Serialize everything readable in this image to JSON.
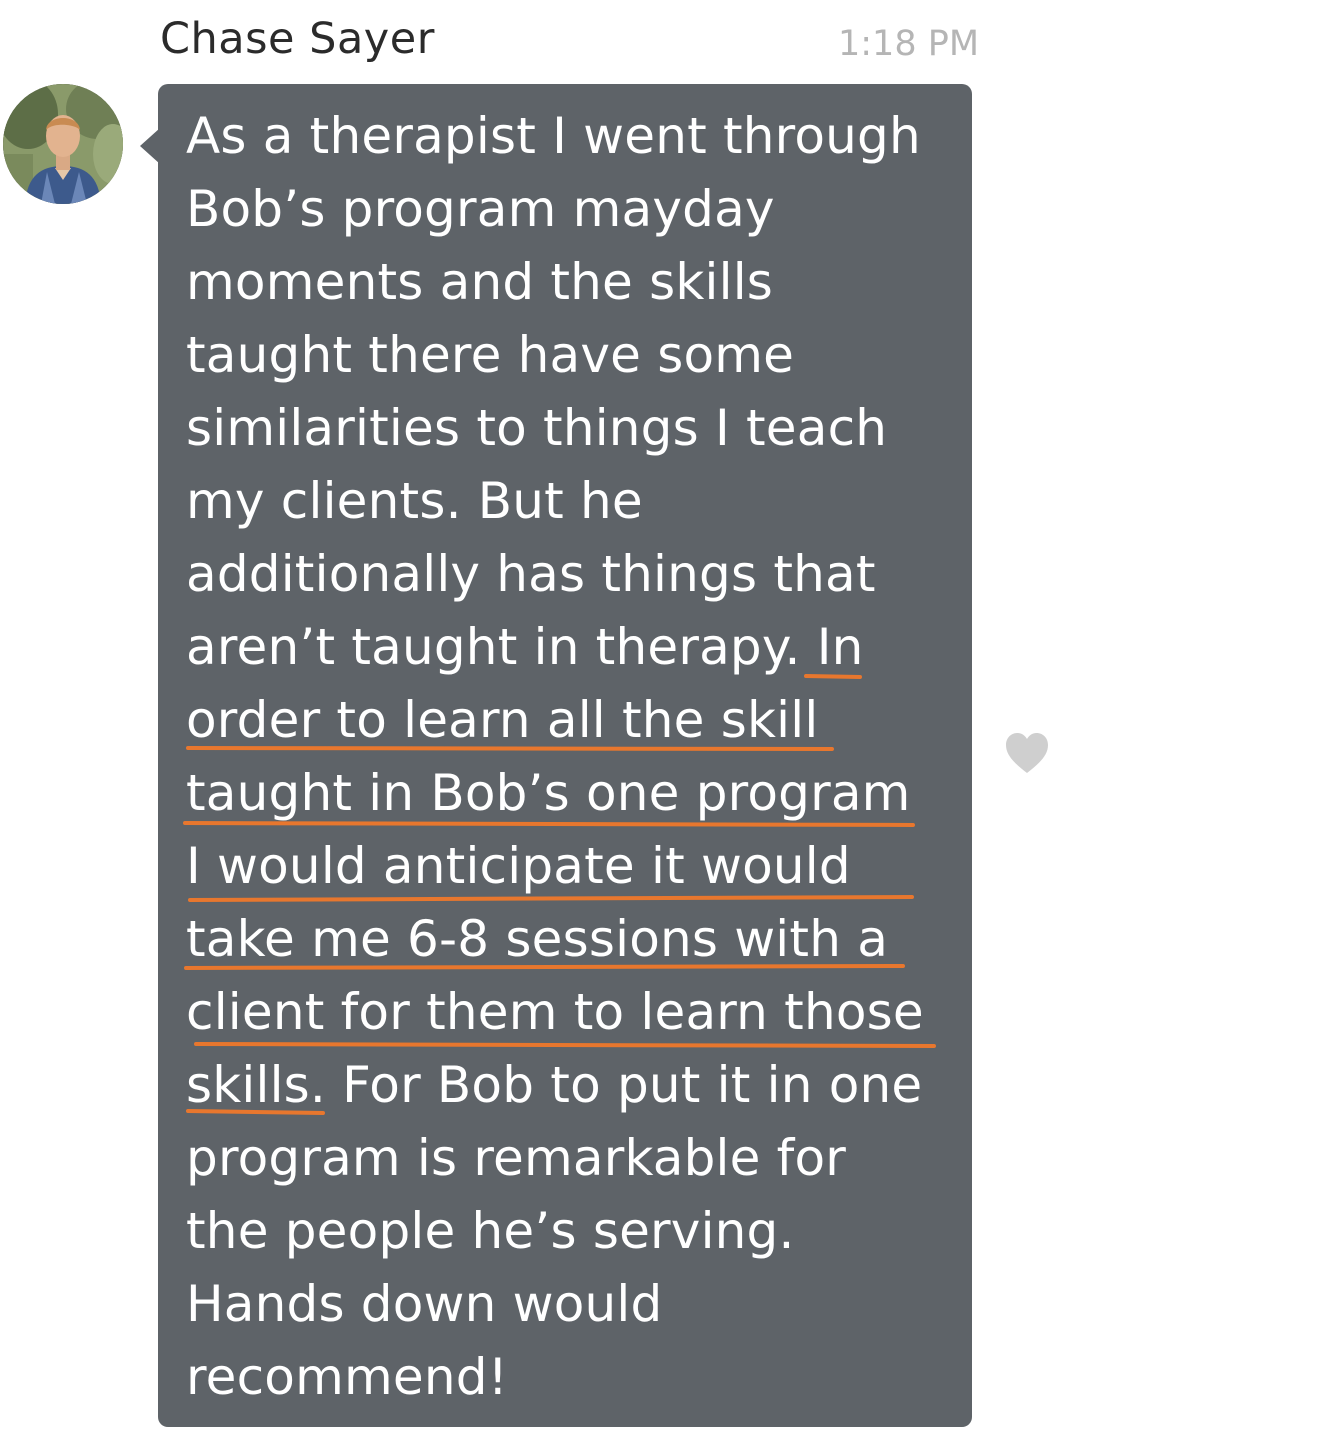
{
  "message": {
    "sender": "Chase Sayer",
    "time": "1:18 PM",
    "avatar": "avatar-photo",
    "lines": [
      "As a therapist I went through",
      "Bob’s program mayday",
      "moments and the skills",
      "taught there have some",
      "similarities to things I teach",
      "my clients. But he",
      "additionally has things that",
      "aren’t taught in therapy. In",
      "order to learn all the skill",
      "taught in Bob’s one program",
      "I would anticipate it would",
      "take me 6-8 sessions with a",
      "client for them to learn those",
      "skills. For Bob to put it in one",
      "program is remarkable for",
      "the people he’s serving.",
      "Hands down would",
      "recommend!"
    ],
    "like_icon": "heart-icon"
  },
  "colors": {
    "bubble": "#5e6368",
    "message_text": "#ffffff",
    "highlight_underline": "#e8772e",
    "timestamp": "#b5b5b5",
    "heart": "#cfcfcf"
  }
}
